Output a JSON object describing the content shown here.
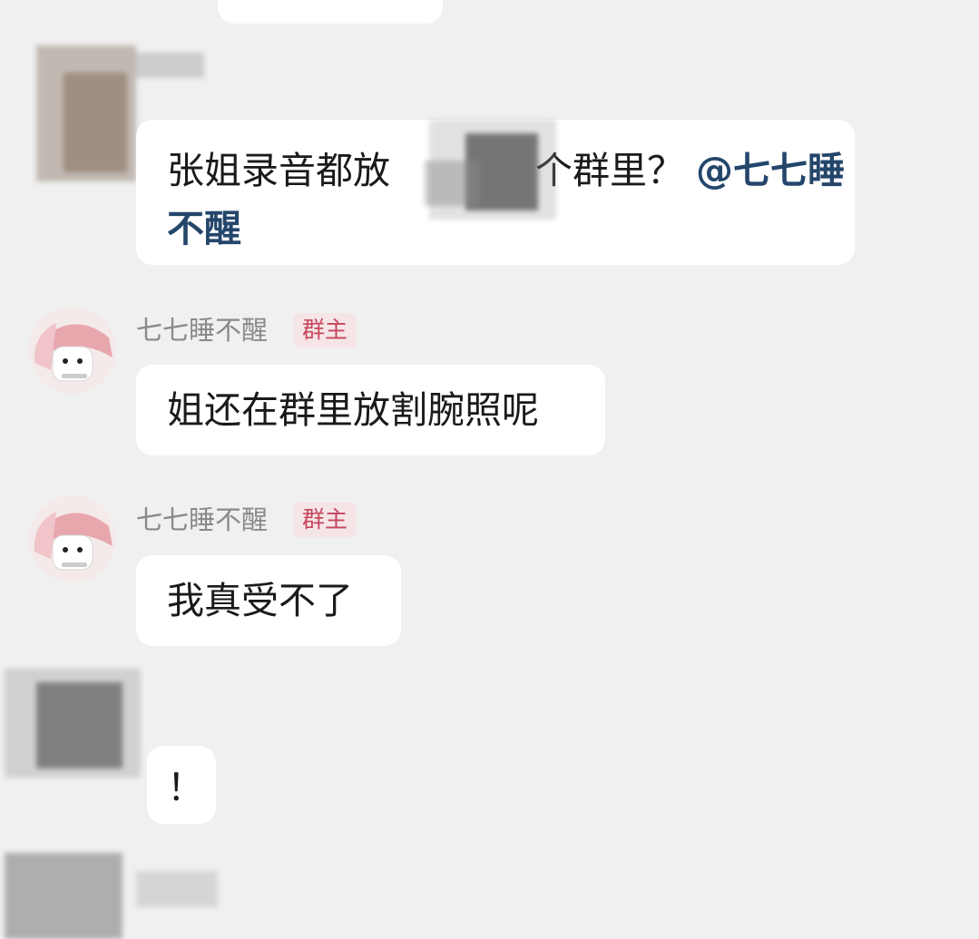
{
  "messages": [
    {
      "text_visible": "张姐录音都放",
      "text_after": "个群里？",
      "mention": "@七七睡不醒"
    },
    {
      "sender": "七七睡不醒",
      "role_badge": "群主",
      "text": "姐还在群里放割腕照呢"
    },
    {
      "sender": "七七睡不醒",
      "role_badge": "群主",
      "text": "我真受不了"
    },
    {
      "text": "！"
    }
  ],
  "colors": {
    "background": "#f0f0f0",
    "bubble": "#ffffff",
    "mention": "#24466b",
    "badge_bg": "#f6e5e7",
    "badge_text": "#c5465d"
  },
  "icons": {
    "owner_avatar": "cartoon-character-avatar-icon"
  }
}
